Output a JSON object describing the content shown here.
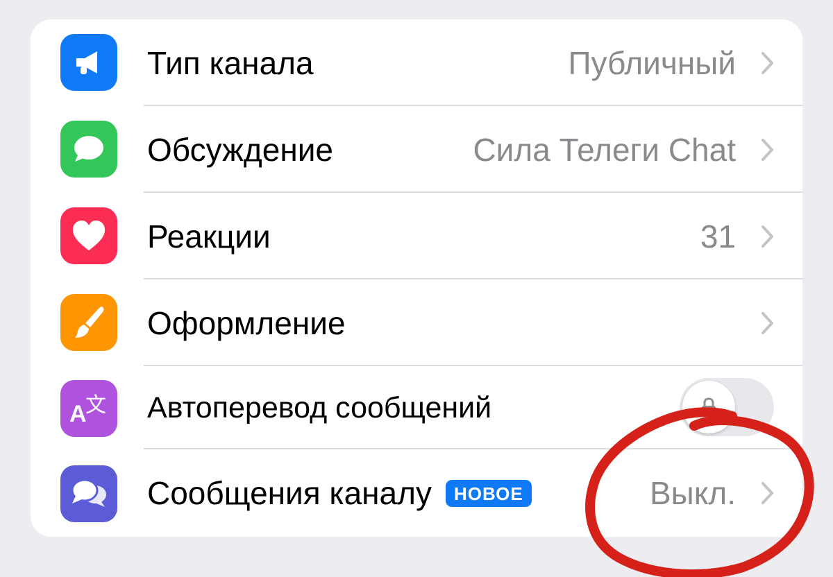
{
  "settings": {
    "rows": [
      {
        "label": "Тип канала",
        "value": "Публичный",
        "icon": "megaphone-icon",
        "icon_color": "#0f79f6"
      },
      {
        "label": "Обсуждение",
        "value": "Сила Телеги Chat",
        "icon": "speech-bubble-icon",
        "icon_color": "#33c658"
      },
      {
        "label": "Реакции",
        "value": "31",
        "icon": "heart-icon",
        "icon_color": "#fb2d55"
      },
      {
        "label": "Оформление",
        "value": "",
        "icon": "paintbrush-icon",
        "icon_color": "#fe9503"
      },
      {
        "label": "Автоперевод сообщений",
        "toggle_on": false,
        "locked": true,
        "icon": "translate-icon",
        "icon_color": "#af52de"
      },
      {
        "label": "Сообщения каналу",
        "badge": "НОВОЕ",
        "value": "Выкл.",
        "icon": "chat-bubbles-icon",
        "icon_color": "#5b5cd6"
      }
    ]
  },
  "colors": {
    "background": "#ededf1",
    "value_text": "#8a8a8e",
    "badge": "#0f79f6",
    "annotation": "#d5211a"
  }
}
